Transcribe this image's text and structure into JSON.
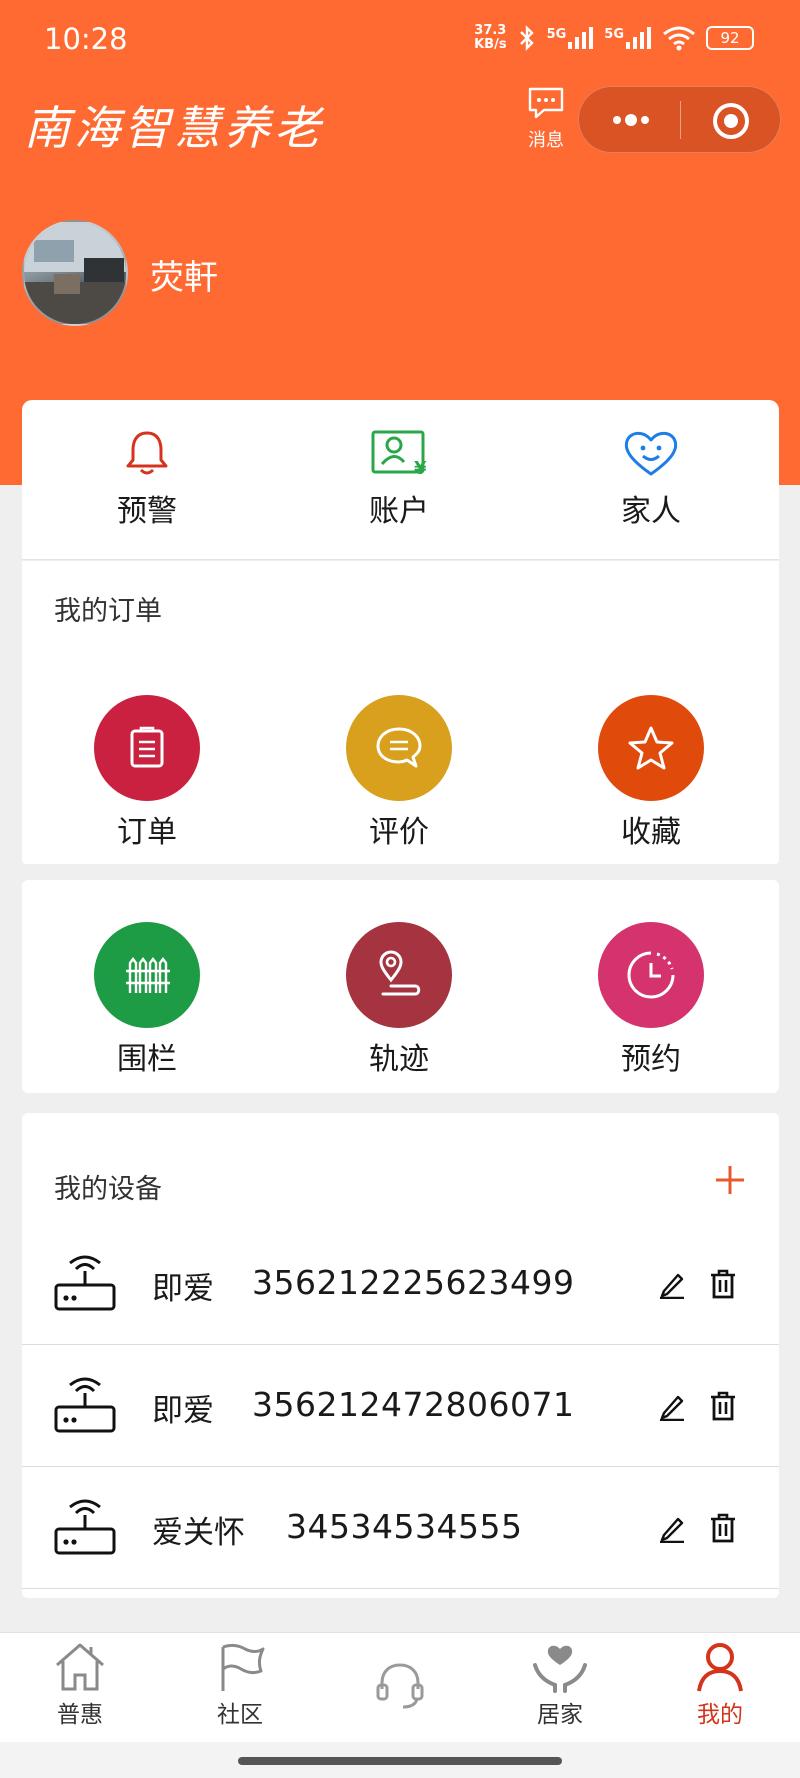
{
  "status_bar": {
    "time": "10:28",
    "speed": "37.3",
    "speed_unit": "KB/s",
    "net1": "5G",
    "net2": "5G",
    "battery": "92"
  },
  "header": {
    "logo_text": "南海智慧养老",
    "message_label": "消息"
  },
  "profile": {
    "name": "荧軒"
  },
  "quick_actions": [
    {
      "label": "预警",
      "icon": "bell-icon",
      "color": "#d4341c"
    },
    {
      "label": "账户",
      "icon": "account-card-icon",
      "color": "#2aa748"
    },
    {
      "label": "家人",
      "icon": "heart-smile-icon",
      "color": "#1e7ee8"
    }
  ],
  "orders": {
    "title": "我的订单",
    "items": [
      {
        "label": "订单",
        "icon": "order-list-icon",
        "color": "#c9213f"
      },
      {
        "label": "评价",
        "icon": "comment-icon",
        "color": "#d8a01c"
      },
      {
        "label": "收藏",
        "icon": "star-icon",
        "color": "#e04b0c"
      }
    ]
  },
  "tools": {
    "items": [
      {
        "label": "围栏",
        "icon": "fence-icon",
        "color": "#1e9b45"
      },
      {
        "label": "轨迹",
        "icon": "location-track-icon",
        "color": "#a63340"
      },
      {
        "label": "预约",
        "icon": "clock-icon",
        "color": "#d4336e"
      }
    ]
  },
  "devices": {
    "title": "我的设备",
    "items": [
      {
        "name": "即爱",
        "number": "356212225623499"
      },
      {
        "name": "即爱",
        "number": "356212472806071"
      },
      {
        "name": "爱关怀",
        "number": "34534534555"
      }
    ]
  },
  "tabbar": {
    "items": [
      {
        "label": "普惠",
        "icon": "house-icon"
      },
      {
        "label": "社区",
        "icon": "flag-icon"
      },
      {
        "label": "",
        "icon": "headset-icon"
      },
      {
        "label": "居家",
        "icon": "hands-heart-icon"
      },
      {
        "label": "我的",
        "icon": "person-icon",
        "active": true
      }
    ],
    "active_color": "#d4341c"
  },
  "theme": {
    "primary": "#ff6a33"
  }
}
